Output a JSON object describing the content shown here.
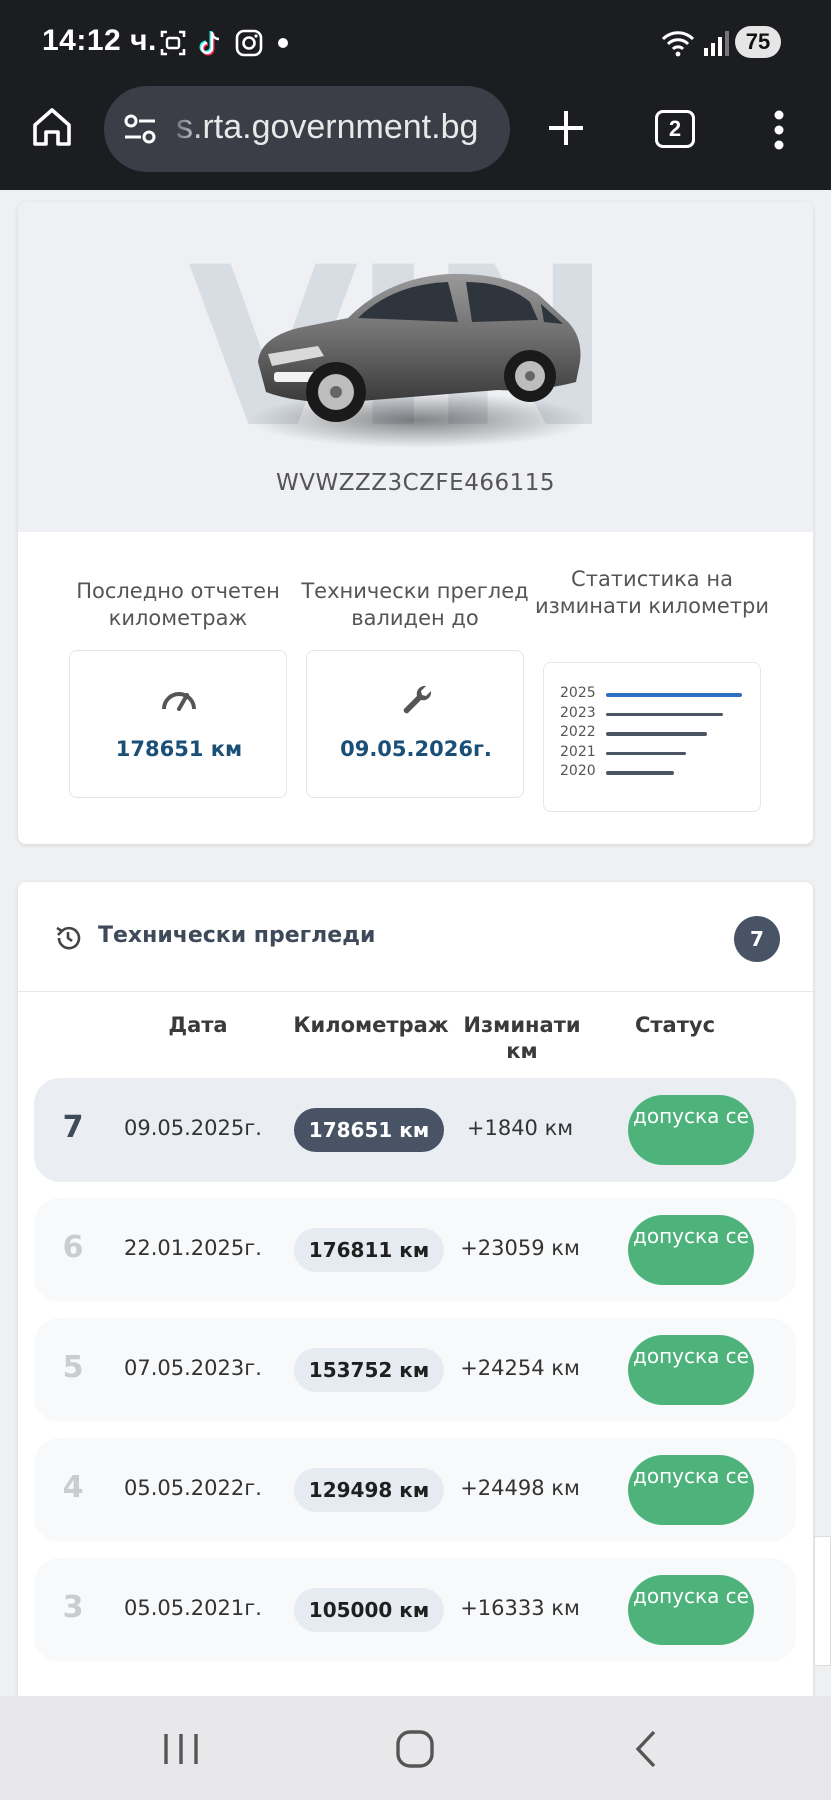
{
  "status_bar": {
    "time": "14:12 ч.",
    "battery": "75",
    "icons": [
      "screenshot-icon",
      "tiktok-icon",
      "instagram-icon",
      "notification-dot",
      "wifi-icon",
      "signal-icon",
      "battery-icon"
    ]
  },
  "browser": {
    "url": "s.rta.government.bg",
    "tabs_count": "2",
    "icons": [
      "home-icon",
      "site-settings-icon",
      "new-tab-icon",
      "tabs-icon",
      "more-icon"
    ]
  },
  "vehicle": {
    "watermark": "VIN",
    "vin": "WVWZZZ3CZFE466115"
  },
  "stats": {
    "mileage_label": "Последно отчетен километраж",
    "mileage_value": "178651 км",
    "inspection_label": "Технически преглед валиден до",
    "inspection_value": "09.05.2026г.",
    "chart_label": "Статистика на изминати километри",
    "chart_years": [
      "2025",
      "2023",
      "2022",
      "2021",
      "2020"
    ],
    "chart_bar_fractions": [
      1.0,
      0.86,
      0.74,
      0.59,
      0.5
    ],
    "chart_highlight_color": "#2d6fc1"
  },
  "inspections": {
    "title": "Технически прегледи",
    "count": "7",
    "headers": {
      "date": "Дата",
      "mileage": "Километраж",
      "diff": "Изминати км",
      "status": "Статус"
    },
    "rows": [
      {
        "num": "7",
        "date": "09.05.2025г.",
        "km": "178651 км",
        "diff": "+1840 км",
        "status": "допуска се"
      },
      {
        "num": "6",
        "date": "22.01.2025г.",
        "km": "176811 км",
        "diff": "+23059 км",
        "status": "допуска се"
      },
      {
        "num": "5",
        "date": "07.05.2023г.",
        "km": "153752 км",
        "diff": "+24254 км",
        "status": "допуска се"
      },
      {
        "num": "4",
        "date": "05.05.2022г.",
        "km": "129498 км",
        "diff": "+24498 км",
        "status": "допуска се"
      },
      {
        "num": "3",
        "date": "05.05.2021г.",
        "km": "105000 км",
        "diff": "+16333 км",
        "status": "допуска се"
      }
    ],
    "status_color": "#4db37b",
    "active_color": "#485466"
  },
  "nav_bar": {
    "icons": [
      "recent-apps-icon",
      "home-button-icon",
      "back-icon"
    ]
  }
}
